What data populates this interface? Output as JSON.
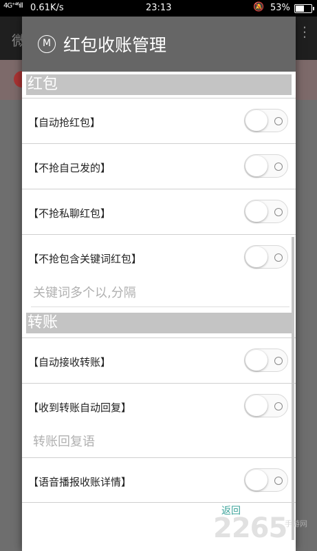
{
  "status_bar": {
    "signal": "4G⁺⁴⁶ıll",
    "net_speed": "0.61K/s",
    "time": "23:13",
    "bell": "🔕",
    "battery_percent": "53%",
    "battery_level": 0.53
  },
  "background": {
    "title": "微",
    "menu": "⋮"
  },
  "dialog": {
    "icon_letter": "M",
    "title": "红包收账管理",
    "sections": {
      "hongbao": "红包",
      "zhuanzhang": "转账"
    },
    "rows": {
      "auto_grab": "【自动抢红包】",
      "not_self": "【不抢自己发的】",
      "not_private": "【不抢私聊红包】",
      "not_keyword": "【不抢包含关键词红包】",
      "auto_receive": "【自动接收转账】",
      "auto_reply": "【收到转账自动回复】",
      "voice_report": "【语音播报收账详情】"
    },
    "inputs": {
      "keyword_placeholder": "关键词多个以,分隔",
      "reply_placeholder": "转账回复语"
    },
    "back_label": "返回"
  },
  "watermark": {
    "main": "2265",
    "sub": "手游网"
  },
  "colors": {
    "header_bg": "#666666",
    "section_bg": "#c4c4c4",
    "back_link": "#3aa39a"
  }
}
